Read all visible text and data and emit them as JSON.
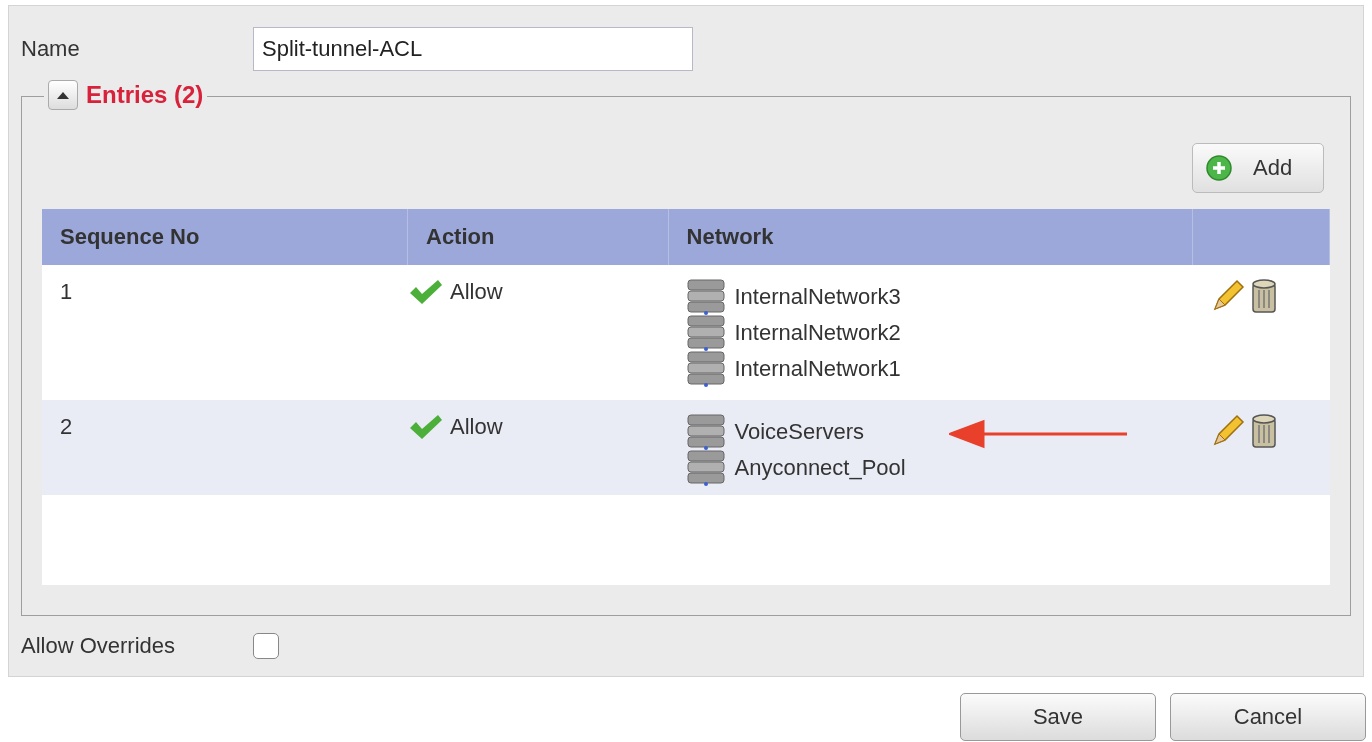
{
  "name_field": {
    "label": "Name",
    "value": "Split-tunnel-ACL"
  },
  "entries": {
    "title": "Entries (2)",
    "expanded": true,
    "add_button": "Add",
    "columns": [
      "Sequence No",
      "Action",
      "Network"
    ],
    "rows": [
      {
        "sequence": "1",
        "action": "Allow",
        "networks": [
          "InternalNetwork3",
          "InternalNetwork2",
          "InternalNetwork1"
        ],
        "marked": false
      },
      {
        "sequence": "2",
        "action": "Allow",
        "networks": [
          "VoiceServers",
          "Anyconnect_Pool"
        ],
        "marked": true
      }
    ]
  },
  "allow_overrides": {
    "label": "Allow Overrides",
    "checked": false
  },
  "buttons": [
    "Save",
    "Cancel"
  ]
}
